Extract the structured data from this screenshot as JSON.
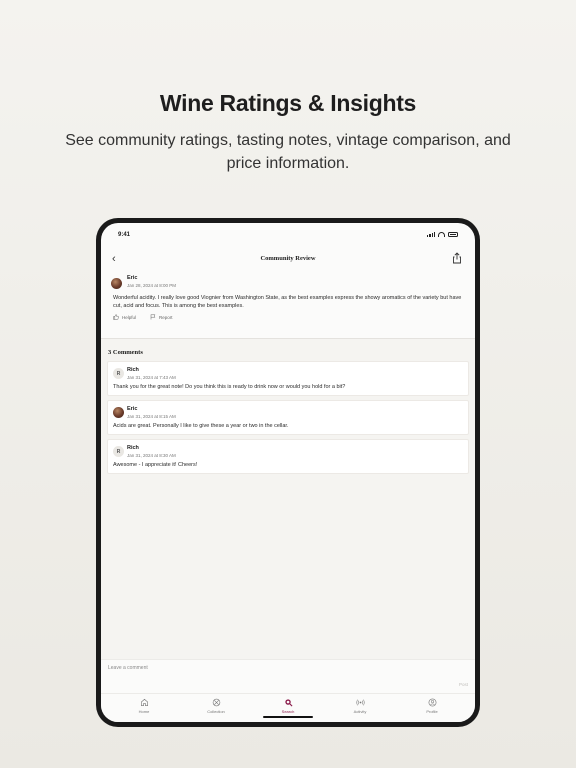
{
  "hero": {
    "title": "Wine Ratings & Insights",
    "subtitle": "See community ratings, tasting notes, vintage comparison, and price information."
  },
  "status_bar": {
    "time": "9:41"
  },
  "nav": {
    "title": "Community Review",
    "back_icon": "chevron-left-icon",
    "share_icon": "share-icon"
  },
  "review": {
    "author": "Eric",
    "date": "Jan 28, 2024 at 8:00 PM",
    "text": "Wonderful acidity. I really love good Viognier from Washington State, as the best examples express the showy aromatics of the variety but have cut, acid and focus. This is among the best examples.",
    "helpful_label": "Helpful",
    "report_label": "Report"
  },
  "comments": {
    "title": "3 Comments",
    "items": [
      {
        "author": "Rich",
        "initial": "R",
        "date": "Jan 31, 2024 at 7:43 AM",
        "text": "Thank you for the great note! Do you think this is ready to drink now or would you hold for a bit?"
      },
      {
        "author": "Eric",
        "initial": "",
        "date": "Jan 31, 2024 at 8:15 AM",
        "text": "Acids are great. Personally I like to give these a year or two in the cellar."
      },
      {
        "author": "Rich",
        "initial": "R",
        "date": "Jan 31, 2024 at 8:30 AM",
        "text": "Awesome - I appreciate it! Cheers!"
      }
    ]
  },
  "composer": {
    "placeholder": "Leave a comment",
    "post_label": "Post"
  },
  "tabs": [
    {
      "label": "Home",
      "icon": "home-icon"
    },
    {
      "label": "Collection",
      "icon": "collection-icon"
    },
    {
      "label": "Search",
      "icon": "search-icon",
      "active": true
    },
    {
      "label": "Activity",
      "icon": "activity-icon"
    },
    {
      "label": "Profile",
      "icon": "profile-icon"
    }
  ],
  "colors": {
    "accent": "#8a1a4a",
    "background": "#f1f0ec",
    "device": "#1a1a1a"
  }
}
